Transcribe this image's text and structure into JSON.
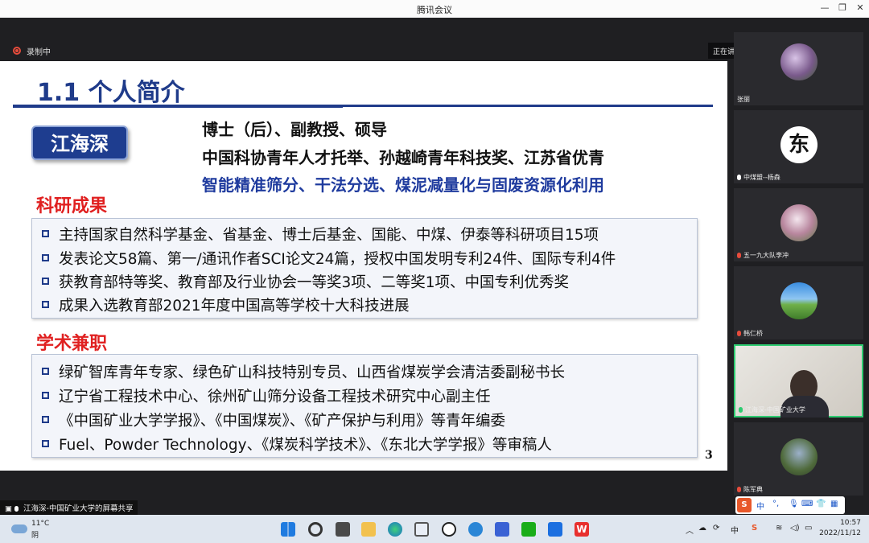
{
  "window": {
    "title": "腾讯会议"
  },
  "meeting": {
    "recording_label": "录制中",
    "speaking_label": "正在讲话: 江海深-中国矿...",
    "share_label": "江海深-中国矿业大学的屏幕共享"
  },
  "slide": {
    "title": "1.1 个人简介",
    "name": "江海深",
    "intro_lines": [
      "博士（后）、副教授、硕导",
      "中国科协青年人才托举、孙越崎青年科技奖、江苏省优青",
      "智能精准筛分、干法分选、煤泥减量化与固废资源化利用"
    ],
    "research": {
      "heading": "科研成果",
      "items": [
        "主持国家自然科学基金、省基金、博士后基金、国能、中煤、伊泰等科研项目15项",
        "发表论文58篇、第一/通讯作者SCI论文24篇，授权中国发明专利24件、国际专利4件",
        "获教育部特等奖、教育部及行业协会一等奖3项、二等奖1项、中国专利优秀奖",
        "成果入选教育部2021年度中国高等学校十大科技进展"
      ]
    },
    "academic": {
      "heading": "学术兼职",
      "items": [
        "绿矿智库青年专家、绿色矿山科技特别专员、山西省煤炭学会清洁委副秘书长",
        "辽宁省工程技术中心、徐州矿山筛分设备工程技术研究中心副主任",
        "《中国矿业大学学报》、《中国煤炭》、《矿产保护与利用》等青年编委",
        "Fuel、Powder Technology、《煤炭科学技术》、《东北大学学报》等审稿人"
      ]
    },
    "page_number": "3"
  },
  "participants": [
    {
      "name": "张丽"
    },
    {
      "name": "中煤盟--杨森",
      "avatar_char": "东"
    },
    {
      "name": "五一九大队李冲"
    },
    {
      "name": "韩仁桥"
    },
    {
      "name": "江海深-中国矿业大学"
    },
    {
      "name": "陈军典"
    }
  ],
  "ime": {
    "lang": "中"
  },
  "taskbar": {
    "temperature": "11°C",
    "weather": "阴",
    "tray_lang": "中",
    "time": "10:57",
    "date": "2022/11/12"
  }
}
